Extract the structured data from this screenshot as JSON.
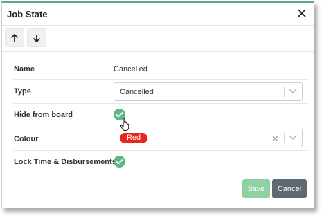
{
  "dialog": {
    "title": "Job State"
  },
  "toolbar": {
    "move_up_icon": "arrow-up",
    "move_down_icon": "arrow-down"
  },
  "fields": {
    "name": {
      "label": "Name",
      "value": "Cancelled"
    },
    "type": {
      "label": "Type",
      "selected": "Cancelled"
    },
    "hide_from_board": {
      "label": "Hide from board",
      "checked": true
    },
    "colour": {
      "label": "Colour",
      "selected": "Red",
      "badge_color": "#e8261f"
    },
    "lock_time": {
      "label": "Lock Time & Disbursements",
      "checked": true
    }
  },
  "buttons": {
    "save": "Save",
    "cancel": "Cancel"
  },
  "colors": {
    "accent": "#5aaa89",
    "check": "#5cb884",
    "save": "#8fd0a3",
    "cancel": "#5f6a70"
  }
}
